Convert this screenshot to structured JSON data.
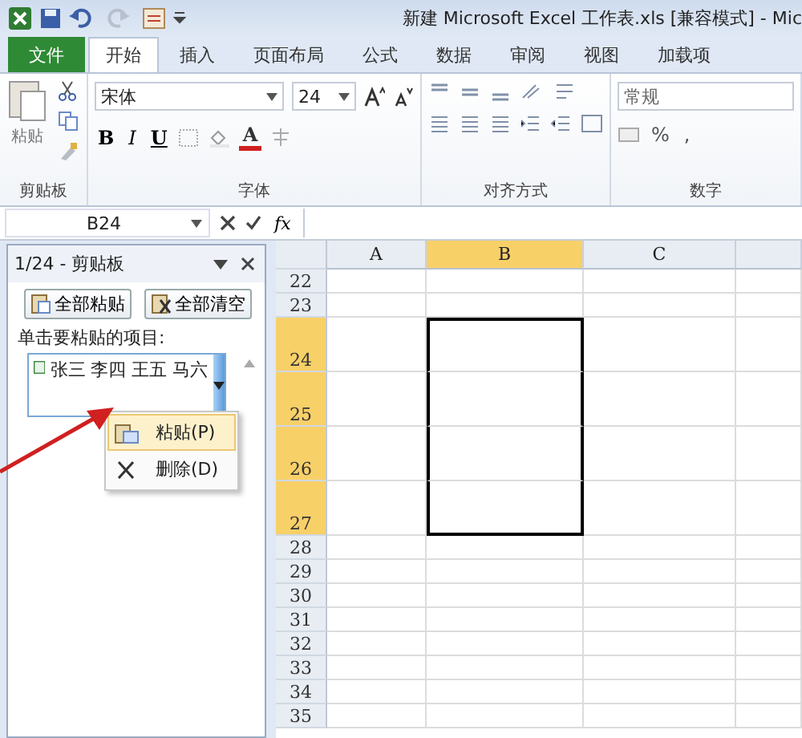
{
  "window": {
    "title": "新建 Microsoft Excel 工作表.xls  [兼容模式] - Mic"
  },
  "tabs": [
    {
      "label": "文件",
      "kind": "file",
      "selected": false
    },
    {
      "label": "开始",
      "kind": "tab",
      "selected": true
    },
    {
      "label": "插入",
      "kind": "tab",
      "selected": false
    },
    {
      "label": "页面布局",
      "kind": "tab",
      "selected": false
    },
    {
      "label": "公式",
      "kind": "tab",
      "selected": false
    },
    {
      "label": "数据",
      "kind": "tab",
      "selected": false
    },
    {
      "label": "审阅",
      "kind": "tab",
      "selected": false
    },
    {
      "label": "视图",
      "kind": "tab",
      "selected": false
    },
    {
      "label": "加载项",
      "kind": "tab",
      "selected": false
    }
  ],
  "ribbon": {
    "clipboard": {
      "paste": "粘贴",
      "label": "剪贴板"
    },
    "font": {
      "font_name": "宋体",
      "font_size": "24",
      "bold": "B",
      "italic": "I",
      "underline": "U",
      "font_color": "A",
      "label": "字体"
    },
    "alignment": {
      "label": "对齐方式"
    },
    "number": {
      "format": "常规",
      "percent": "%",
      "comma": ",",
      "label": "数字"
    }
  },
  "formula_bar": {
    "name_box": "B24",
    "fx": "fx"
  },
  "clipboard_pane": {
    "title": "1/24 - 剪贴板",
    "buttons": [
      "全部粘贴",
      "全部清空"
    ],
    "instruction": "单击要粘贴的项目:",
    "items": [
      {
        "text": "张三  李四  王五  马六",
        "selected": true
      }
    ]
  },
  "context_menu": [
    {
      "label": "粘贴(P)",
      "kind": "paste",
      "selected": true
    },
    {
      "label": "删除(D)",
      "kind": "delete",
      "selected": false
    }
  ],
  "grid": {
    "columns": [
      {
        "label": "A",
        "selected": false
      },
      {
        "label": "B",
        "selected": true
      },
      {
        "label": "C",
        "selected": false
      }
    ],
    "rows": [
      {
        "label": "22",
        "kind": "normal",
        "selected": false
      },
      {
        "label": "23",
        "kind": "normal",
        "selected": false
      },
      {
        "label": "24",
        "kind": "tall",
        "selected": true
      },
      {
        "label": "25",
        "kind": "tall",
        "selected": true
      },
      {
        "label": "26",
        "kind": "tall",
        "selected": true
      },
      {
        "label": "27",
        "kind": "tall",
        "selected": true
      },
      {
        "label": "28",
        "kind": "normal",
        "selected": false
      },
      {
        "label": "29",
        "kind": "normal",
        "selected": false
      },
      {
        "label": "30",
        "kind": "normal",
        "selected": false
      },
      {
        "label": "31",
        "kind": "normal",
        "selected": false
      },
      {
        "label": "32",
        "kind": "normal",
        "selected": false
      },
      {
        "label": "33",
        "kind": "normal",
        "selected": false
      },
      {
        "label": "34",
        "kind": "normal",
        "selected": false
      },
      {
        "label": "35",
        "kind": "normal",
        "selected": false
      }
    ]
  }
}
